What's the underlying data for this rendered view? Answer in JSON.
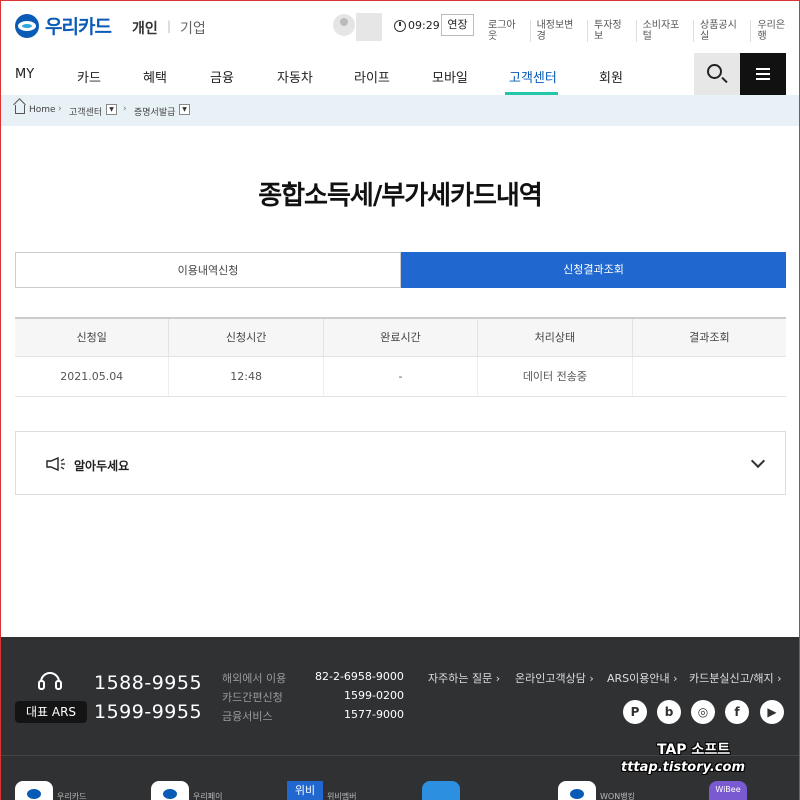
{
  "header": {
    "brand": "우리카드",
    "segments": [
      "개인",
      "기업"
    ],
    "divider": "|",
    "session_timer": "09:29",
    "extend_label": "연장",
    "utility_links": [
      "로그아웃",
      "내정보변경",
      "투자정보",
      "소비자포털",
      "상품공시실",
      "우리은행"
    ]
  },
  "nav": {
    "items": [
      "MY",
      "카드",
      "혜택",
      "금융",
      "자동차",
      "라이프",
      "모바일",
      "고객센터",
      "회원"
    ],
    "active": "고객센터",
    "accent_color": "#24c6a9"
  },
  "breadcrumb": {
    "home": "Home",
    "level1": "고객센터",
    "level2": "증명서발급"
  },
  "page": {
    "title": "종합소득세/부가세카드내역"
  },
  "tabs": [
    {
      "label": "이용내역신청",
      "active": false
    },
    {
      "label": "신청결과조회",
      "active": true
    }
  ],
  "table": {
    "headers": [
      "신청일",
      "신청시간",
      "완료시간",
      "처리상태",
      "결과조회"
    ],
    "rows": [
      [
        "2021.05.04",
        "12:48",
        "-",
        "데이터 전송중",
        ""
      ]
    ]
  },
  "notice": {
    "title": "알아두세요"
  },
  "footer": {
    "ars_label": "대표 ARS",
    "phones": [
      "1588-9955",
      "1599-9955"
    ],
    "services": [
      {
        "label": "해외에서 이용",
        "number": "82-2-6958-9000"
      },
      {
        "label": "카드간편신청",
        "number": "1599-0200"
      },
      {
        "label": "금융서비스",
        "number": "1577-9000"
      }
    ],
    "quick_links": [
      "자주하는 질문 ›",
      "온라인고객상담 ›",
      "ARS이용안내 ›",
      "카드분실신고/해지 ›"
    ],
    "social_icons": [
      "pay-icon",
      "blog-icon",
      "instagram-icon",
      "facebook-icon",
      "youtube-icon"
    ],
    "social_glyphs": [
      "P",
      "b",
      "◎",
      "f",
      "▶"
    ],
    "apps": [
      "우리카드",
      "우리페이",
      "위비",
      "위비멤버",
      "WON뱅킹",
      "WiBee"
    ]
  },
  "watermark": {
    "line1": "TAP 소프트",
    "line2": "tttap.tistory.com"
  },
  "colors": {
    "brand_blue": "#0a5bb5",
    "tab_active": "#2067cf",
    "footer_bg": "#2f3133",
    "breadcrumb_bg": "#e8f1f6"
  }
}
